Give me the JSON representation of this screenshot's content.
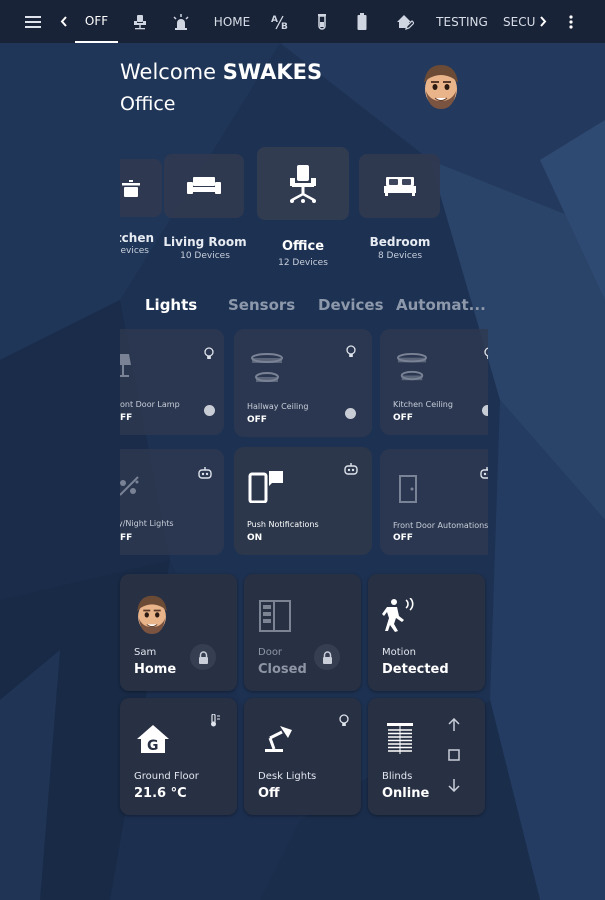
{
  "topbar": {
    "tabs": [
      {
        "label": "OFF",
        "icon": "text",
        "active": true
      },
      {
        "label": "",
        "icon": "office-chair-icon"
      },
      {
        "label": "",
        "icon": "alarm-light-icon"
      },
      {
        "label": "HOME",
        "icon": "text"
      },
      {
        "label": "",
        "icon": "ab-test-icon"
      },
      {
        "label": "",
        "icon": "test-tube-icon"
      },
      {
        "label": "",
        "icon": "battery-icon"
      },
      {
        "label": "",
        "icon": "home-edit-icon"
      },
      {
        "label": "TESTING",
        "icon": "text"
      },
      {
        "label": "SECU",
        "icon": "text"
      }
    ]
  },
  "header": {
    "welcome_prefix": "Welcome",
    "username": "SWAKES",
    "room": "Office"
  },
  "rooms": [
    {
      "name": "tchen",
      "devices": "Devices",
      "icon": "pot-icon"
    },
    {
      "name": "Living Room",
      "devices": "10 Devices",
      "icon": "sofa-icon"
    },
    {
      "name": "Office",
      "devices": "12 Devices",
      "icon": "office-chair-icon",
      "selected": true
    },
    {
      "name": "Bedroom",
      "devices": "8 Devices",
      "icon": "bed-icon"
    }
  ],
  "section_tabs": [
    "Lights",
    "Sensors",
    "Devices",
    "Automat..."
  ],
  "device_tiles": [
    {
      "name": "ont Door Lamp",
      "state": "FF",
      "icon": "lamp-icon",
      "badge": "lightbulb-icon"
    },
    {
      "name": "Hallway Ceiling",
      "state": "OFF",
      "icon": "ceiling-light-icon",
      "badge": "lightbulb-icon"
    },
    {
      "name": "Kitchen Ceiling",
      "state": "OFF",
      "icon": "ceiling-light-icon",
      "badge": "lightbulb-icon"
    },
    {
      "name": "y/Night Lights",
      "state": "FF",
      "icon": "weather-night-icon",
      "badge": "robot-icon"
    },
    {
      "name": "Push Notifications",
      "state": "ON",
      "icon": "cellphone-message-icon",
      "badge": "robot-icon"
    },
    {
      "name": "Front Door Automations",
      "state": "OFF",
      "icon": "door-icon",
      "badge": "robot-icon"
    }
  ],
  "cards": {
    "sam": {
      "name": "Sam",
      "state": "Home"
    },
    "door": {
      "name": "Door",
      "state": "Closed"
    },
    "motion": {
      "name": "Motion",
      "state": "Detected"
    },
    "ground": {
      "name": "Ground Floor",
      "state": "21.6 °C"
    },
    "desk": {
      "name": "Desk Lights",
      "state": "Off"
    },
    "blinds": {
      "name": "Blinds",
      "state": "Online"
    }
  },
  "colors": {
    "topbar": "#192337",
    "card": "#283043",
    "background": "#1b2e4d",
    "inactive_tab": "#8d99ab"
  }
}
